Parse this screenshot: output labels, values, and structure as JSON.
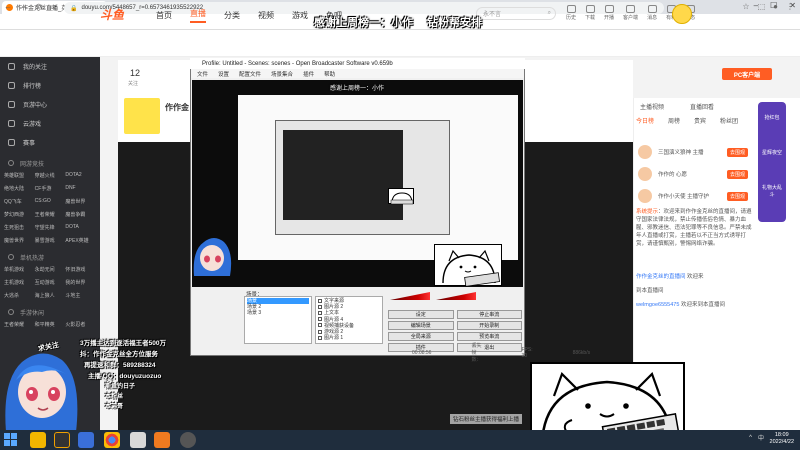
{
  "browser": {
    "tab_title": "作作金克丝直播_英雄联盟直播_",
    "new_tab": "+",
    "url": "douyu.com/5448657_r=0.6573461935522922",
    "nav": [
      "←",
      "→",
      "⟳",
      "⌂"
    ],
    "window_controls": [
      "–",
      "☐",
      "✕"
    ]
  },
  "banner": {
    "text1": "感谢上周榜一：小作",
    "text2": "钻粉帮安排"
  },
  "douyu": {
    "logo": "斗鱼",
    "nav": [
      "首页",
      "直播",
      "分类",
      "视频",
      "游戏",
      "鱼吧"
    ],
    "active_nav": "直播",
    "search_placeholder": "永不言",
    "header_icons": [
      "历史",
      "下载",
      "开播",
      "客户端",
      "消息",
      "有料",
      "动态"
    ],
    "fans": "12",
    "fans_label": "关注",
    "room_title": "作作金",
    "pc_button": "PC客户端"
  },
  "sidebar": {
    "items": [
      "我的关注",
      "排行榜",
      "页游中心",
      "云游戏",
      "赛事"
    ],
    "sections": [
      {
        "title": "网游竞技",
        "items": [
          "英雄联盟",
          "穿越火线",
          "DOTA2",
          "绝地大陆",
          "CF手游",
          "DNF",
          "QQ飞车",
          "CS:GO",
          "魔兽世界",
          "梦幻西游",
          "王者荣耀",
          "魔兽争霸",
          "生死狙击",
          "守望先锋",
          "DOTA",
          "魔兽世界",
          "暴雪游戏",
          "APEX英雄"
        ]
      },
      {
        "title": "单机热游",
        "items": [
          "单机游戏",
          "永劫无间",
          "怀旧游戏",
          "主机游戏",
          "互动游戏",
          "我的世界",
          "大逃杀",
          "海上狼人",
          "斗地主"
        ]
      },
      {
        "title": "手游休闲",
        "items": [
          "王者荣耀",
          "和平精英",
          "火影忍者"
        ]
      }
    ]
  },
  "right_panel": {
    "top": [
      "主播视频",
      "直播回看"
    ],
    "tabs": [
      "今日榜",
      "周榜",
      "贵宾",
      "粉丝团"
    ],
    "ranks": [
      {
        "name": "三国演义狼神 主播",
        "btn": "去围观"
      },
      {
        "name": "作作的 心愿",
        "btn": "去围观"
      },
      {
        "name": "作作小天使 主播守护",
        "btn": "去围观"
      }
    ],
    "sys_tag": "系统提示",
    "sys_msg": "：欢迎来到作作金克丝的直播间，请遵守国家法律法规，禁止传播低俗色情、暴力血腥、邪教迷信、违法犯罪等不良信息。严禁未成年人直播或打赏，主播若以不正当方式诱导打赏，请谨慎甄别，警惕网络诈骗。",
    "chat": [
      {
        "user": "作作金克丝的直播间",
        "text": "欢迎来"
      },
      {
        "user": "",
        "text": "到本直播间"
      },
      {
        "user": "welmgoe6555475",
        "text": "欢迎来到本直播间"
      }
    ],
    "side_btns": [
      "抢红包",
      "星辉夜空",
      "礼物大乱斗"
    ]
  },
  "obs": {
    "title": "Profile: Untitled - Scenes: scenes - Open Broadcaster Software v0.659b",
    "menu": [
      "文件",
      "设置",
      "配置文件",
      "场景集合",
      "插件",
      "帮助"
    ],
    "scene_label": "场景：",
    "scenes": [
      "场景",
      "场景 2",
      "场景 3"
    ],
    "sources": [
      "文字来源",
      "图片源 2",
      "上文本",
      "图片源 4",
      "视频捕获设备",
      "游戏源 2",
      "图片源 1",
      "游戏"
    ],
    "buttons": [
      "设定",
      "停止串流",
      "编辑场景",
      "开始录制",
      "全局来源",
      "预览串流",
      "插件",
      "退出"
    ],
    "status": [
      "00:08:56",
      "丢失帧数：",
      "FPS: 30",
      "886kb/s"
    ],
    "nested_title": "感谢上周榜一：小作"
  },
  "overlay": {
    "watch_label": "求关注",
    "lines": [
      "3万播主达到逐活福王者500万",
      "抖：作作金克丝全方位服务",
      "再提速和群：589288324",
      "主播 QQ：douyuzuozuo",
      "斯鱼钓日子",
      "本粉丝",
      "本弟哥"
    ],
    "notice": "钻石粉丝主播获得福利上播"
  },
  "taskbar": {
    "clock_time": "18:09",
    "clock_date": "2022/4/22",
    "tray": [
      "^",
      "中"
    ]
  }
}
